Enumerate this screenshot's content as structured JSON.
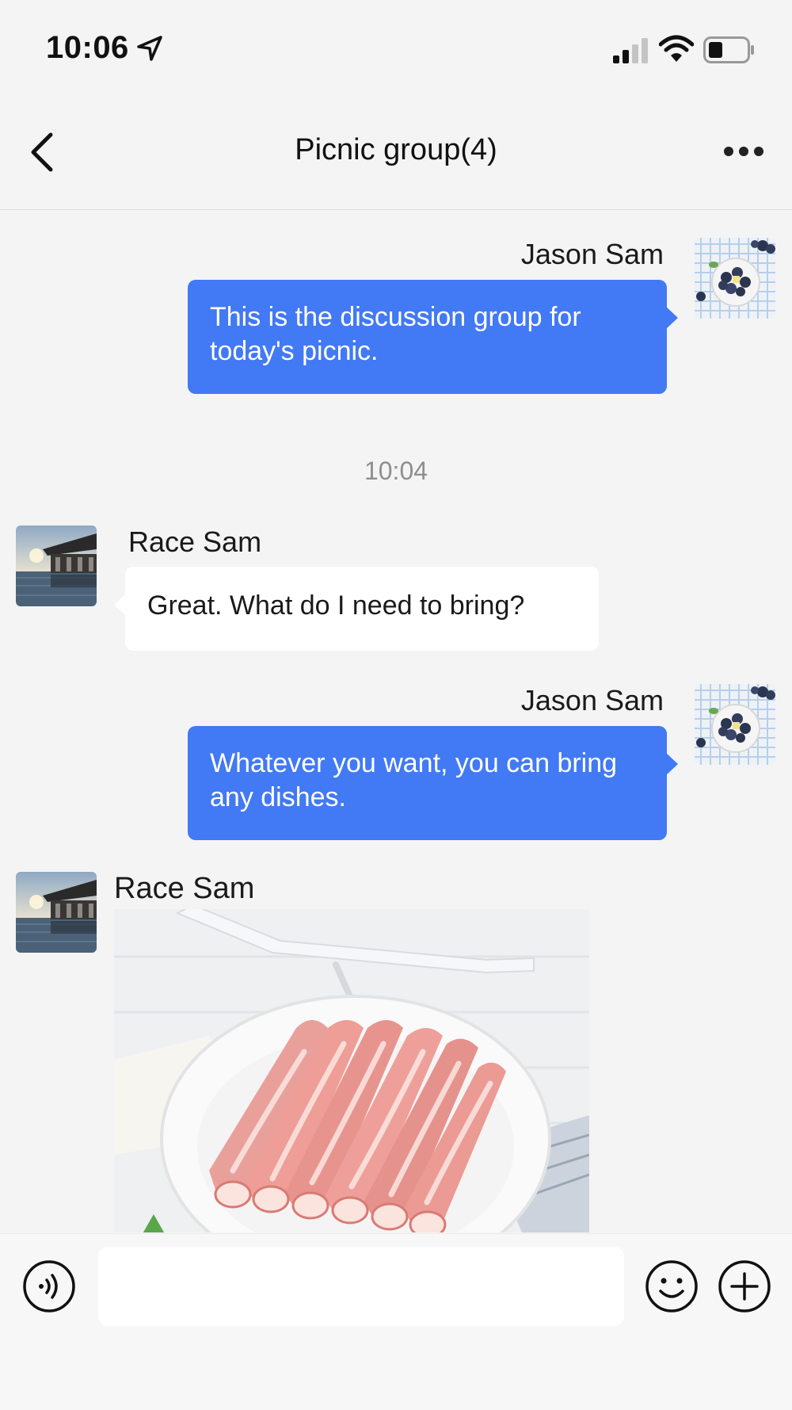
{
  "status_bar": {
    "time": "10:06",
    "icons": [
      "location-arrow-icon",
      "cellular-signal-icon",
      "wifi-icon",
      "battery-icon"
    ]
  },
  "header": {
    "title": "Picnic group(4)",
    "back_icon": "chevron-left-icon",
    "more_icon": "more-dots-icon"
  },
  "messages": [
    {
      "sender": "Jason Sam",
      "direction": "outgoing",
      "text": "This is the discussion group for today's picnic.",
      "avatar": "blueberries-photo"
    },
    {
      "timestamp": "10:04"
    },
    {
      "sender": "Race Sam",
      "direction": "incoming",
      "text": "Great. What do I need to bring?",
      "avatar": "poolside-building-photo"
    },
    {
      "sender": "Jason Sam",
      "direction": "outgoing",
      "text": "Whatever you want, you can bring any dishes.",
      "avatar": "blueberries-photo"
    },
    {
      "sender": "Race Sam",
      "direction": "incoming",
      "image": "sliced-meat-rolls-photo",
      "avatar": "poolside-building-photo"
    }
  ],
  "input_bar": {
    "message_value": "",
    "placeholder": "",
    "icons": [
      "voice-icon",
      "emoji-icon",
      "plus-icon"
    ]
  },
  "colors": {
    "outgoing_bubble": "#4279f4",
    "incoming_bubble": "#ffffff",
    "background": "#f4f4f4"
  }
}
